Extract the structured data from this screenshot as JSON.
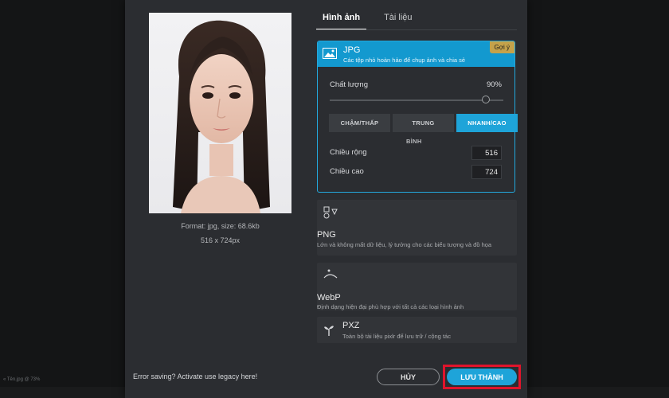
{
  "backdrop": {
    "corner_text": "« Tên.jpg @ 73%"
  },
  "preview": {
    "format_line": "Format: jpg, size: 68.6kb",
    "dimensions_line": "516 x 724px"
  },
  "tabs": [
    {
      "label": "Hình ảnh",
      "active": true
    },
    {
      "label": "Tài liệu",
      "active": false
    }
  ],
  "jpg": {
    "title": "JPG",
    "description": "Các tệp nhỏ hoàn hảo để chụp ảnh và chia sẻ",
    "badge": "Gợi ý",
    "quality_label": "Chất lượng",
    "quality_value": "90%",
    "quality_fraction": 0.9,
    "speed_options": [
      "CHẬM/THẤP",
      "TRUNG",
      "NHANH/CAO"
    ],
    "speed_sub": "BÌNH",
    "selected_speed": 2,
    "width_label": "Chiều rộng",
    "width_value": "516",
    "height_label": "Chiều cao",
    "height_value": "724"
  },
  "formats": [
    {
      "title": "PNG",
      "description": "Lớn và không mất dữ liệu, lý tưởng cho các biểu tượng và đồ họa",
      "icon": "shapes-icon"
    },
    {
      "title": "WebP",
      "description": "Định dạng hiện đại phù hợp với tất cả các loại hình ảnh",
      "icon": "webp-icon"
    },
    {
      "title": "PXZ",
      "description": "Toàn bộ tài liệu pixlr để lưu trữ / cộng tác",
      "icon": "sprout-icon"
    }
  ],
  "footer": {
    "legacy_text": "Error saving? Activate use legacy here!",
    "cancel_label": "HỦY",
    "save_label": "LƯU THÀNH"
  },
  "colors": {
    "accent": "#1ea4d9",
    "badge": "#c5a24a",
    "highlight": "#e0142b",
    "dialog_bg": "#2b2d31"
  }
}
